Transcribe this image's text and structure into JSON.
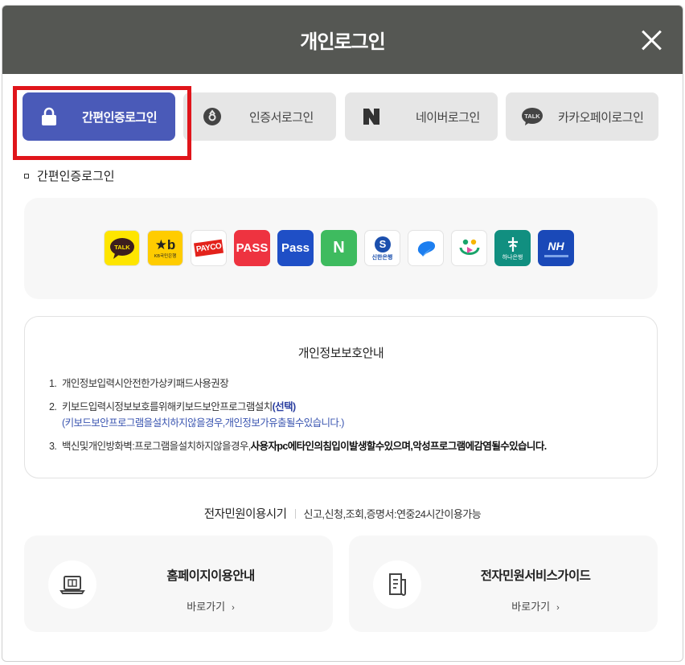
{
  "header": {
    "title": "개인로그인"
  },
  "tabs": [
    {
      "label": "간편인증로그인",
      "icon": "lock-icon",
      "active": true
    },
    {
      "label": "인증서로그인",
      "icon": "certificate-icon",
      "active": false
    },
    {
      "label": "네이버로그인",
      "icon": "naver-icon",
      "active": false
    },
    {
      "label": "카카오페이로그인",
      "icon": "kakao-talk-icon",
      "active": false
    }
  ],
  "section_title": "간편인증로그인",
  "auth_providers": [
    {
      "name": "kakao",
      "label": "TALK",
      "bg": "#fee500",
      "fg": "#3c1e1e"
    },
    {
      "name": "kb",
      "label": "KB국민은행",
      "bg": "#ffcc00",
      "fg": "#222"
    },
    {
      "name": "payco",
      "label": "PAYCO",
      "bg": "#ffffff",
      "fg": "#e3221b"
    },
    {
      "name": "pass-red",
      "label": "PASS",
      "bg": "#ee3340",
      "fg": "#ffffff"
    },
    {
      "name": "pass-blue",
      "label": "Pass",
      "bg": "#1f4fc6",
      "fg": "#ffffff"
    },
    {
      "name": "naver",
      "label": "N",
      "bg": "#3ebb5f",
      "fg": "#ffffff"
    },
    {
      "name": "shinhan",
      "label": "신한은행",
      "bg": "#ffffff",
      "fg": "#1b4fad"
    },
    {
      "name": "toss",
      "label": "",
      "bg": "#ffffff",
      "fg": "#1c7ef0"
    },
    {
      "name": "samsung-pass",
      "label": "",
      "bg": "#ffffff",
      "fg": "#1aa46b"
    },
    {
      "name": "hana",
      "label": "하나은행",
      "bg": "#118f80",
      "fg": "#ffffff"
    },
    {
      "name": "nh",
      "label": "NH",
      "bg": "#1a49b8",
      "fg": "#ffffff"
    }
  ],
  "privacy": {
    "title": "개인정보보호안내",
    "item1": "개인정보입력시안전한가상키패드사용권장",
    "item2": "키보드입력시정보보호를위해키보드보안프로그램설치",
    "item2_highlight": "(선택)",
    "item2_sub": "(키보드보안프로그램을설치하지않을경우,개인정보가유출될수있습니다.)",
    "item3": "백신및개인방화벽:프로그램을설치하지않을경우,",
    "item3_bold": "사용자pc에타인의침입이발생할수있으며,악성프로그램에감염될수있습니다."
  },
  "usage": {
    "title": "전자민원이용시기",
    "desc": "신고,신청,조회,증명서:연중24시간이용가능"
  },
  "cards": [
    {
      "title": "홈페이지이용안내",
      "link": "바로가기",
      "icon": "laptop-icon"
    },
    {
      "title": "전자민원서비스가이드",
      "link": "바로가기",
      "icon": "document-icon"
    }
  ]
}
